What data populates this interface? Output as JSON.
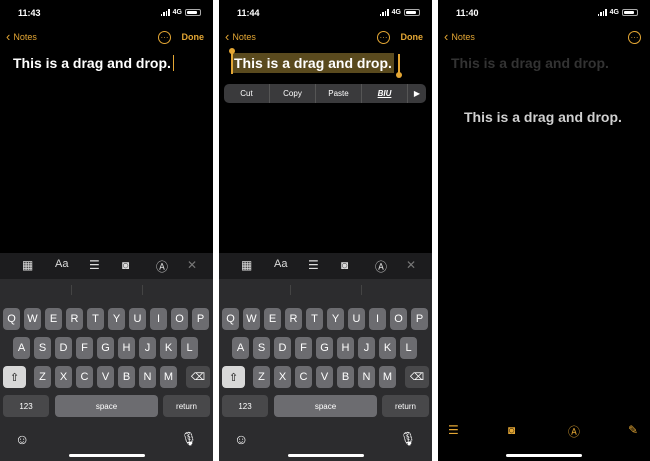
{
  "panels": [
    {
      "time": "11:43",
      "network": "4G",
      "back_label": "Notes",
      "done_label": "Done",
      "note_text": "This is a drag and drop."
    },
    {
      "time": "11:44",
      "network": "4G",
      "back_label": "Notes",
      "done_label": "Done",
      "note_text": "This is a drag and drop."
    },
    {
      "time": "11:40",
      "network": "4G",
      "back_label": "Notes",
      "note_text": "This is a drag and drop.",
      "dragged_text": "This is a drag and drop."
    }
  ],
  "edit_menu": {
    "cut": "Cut",
    "copy": "Copy",
    "paste": "Paste",
    "format": "BIU",
    "more": "▶"
  },
  "keyboard": {
    "row1": [
      "Q",
      "W",
      "E",
      "R",
      "T",
      "Y",
      "U",
      "I",
      "O",
      "P"
    ],
    "row2": [
      "A",
      "S",
      "D",
      "F",
      "G",
      "H",
      "J",
      "K",
      "L"
    ],
    "row3": [
      "Z",
      "X",
      "C",
      "V",
      "B",
      "N",
      "M"
    ],
    "numbers": "123",
    "space": "space",
    "return": "return"
  },
  "icons": {
    "back": "chevron-left-icon",
    "more": "ellipsis-circle-icon",
    "table": "table-icon",
    "format": "text-format-icon",
    "checklist": "checklist-icon",
    "camera": "camera-icon",
    "markup": "markup-pen-icon",
    "close": "close-icon",
    "shift": "shift-icon",
    "delete": "delete-icon",
    "emoji": "emoji-icon",
    "mic": "microphone-icon",
    "compose": "compose-icon"
  },
  "colors": {
    "accent": "#e3a634",
    "background": "#000000",
    "key": "#6c6c70",
    "keyboard": "#2c2c2e"
  }
}
